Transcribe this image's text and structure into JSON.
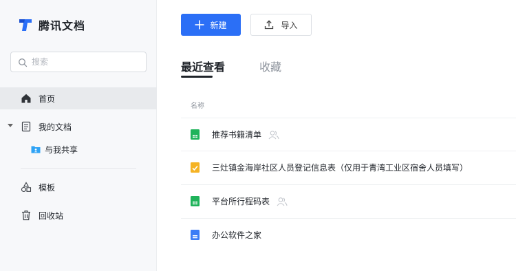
{
  "brand": {
    "name": "腾讯文档",
    "accent": "#2b6ff6"
  },
  "search": {
    "placeholder": "搜索"
  },
  "sidebar": {
    "items": [
      {
        "label": "首页",
        "icon": "home-icon",
        "active": true
      },
      {
        "label": "我的文档",
        "icon": "document-icon"
      },
      {
        "label": "与我共享",
        "icon": "shared-folder-icon"
      },
      {
        "label": "模板",
        "icon": "shapes-icon"
      },
      {
        "label": "回收站",
        "icon": "trash-icon"
      }
    ]
  },
  "toolbar": {
    "new_label": "新建",
    "import_label": "导入"
  },
  "tabs": [
    {
      "label": "最近查看",
      "active": true
    },
    {
      "label": "收藏"
    }
  ],
  "list": {
    "column_name": "名称",
    "rows": [
      {
        "name": "推荐书籍清单",
        "type": "sheet",
        "color": "#1fb35a",
        "shared": true
      },
      {
        "name": "三灶镇金海岸社区人员登记信息表（仅用于青湾工业区宿舍人员填写）",
        "type": "form",
        "color": "#f5b324",
        "shared": false
      },
      {
        "name": "平台所行程码表",
        "type": "sheet",
        "color": "#1fb35a",
        "shared": true
      },
      {
        "name": "办公软件之家",
        "type": "doc",
        "color": "#3b7cf6",
        "shared": false
      }
    ]
  }
}
